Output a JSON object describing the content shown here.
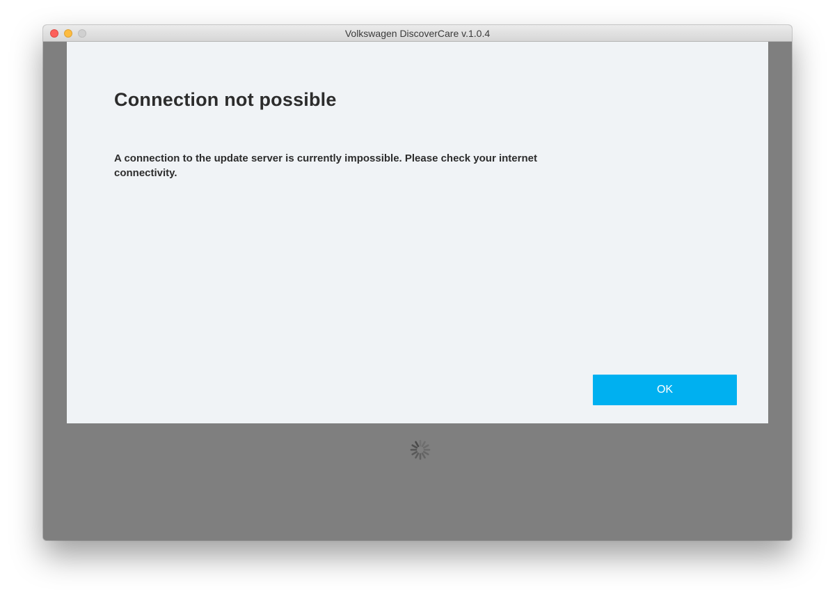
{
  "window": {
    "title": "Volkswagen DiscoverCare v.1.0.4"
  },
  "dialog": {
    "title": "Connection not possible",
    "message": "A connection to the update server is currently impossible. Please check your internet connectivity.",
    "ok_label": "OK"
  },
  "colors": {
    "accent": "#00b0f0",
    "overlay": "#7f7f7f",
    "dialog_background": "#f0f3f6",
    "text": "#2c2c2c"
  },
  "icons": {
    "spinner": "loading-spinner-icon"
  }
}
